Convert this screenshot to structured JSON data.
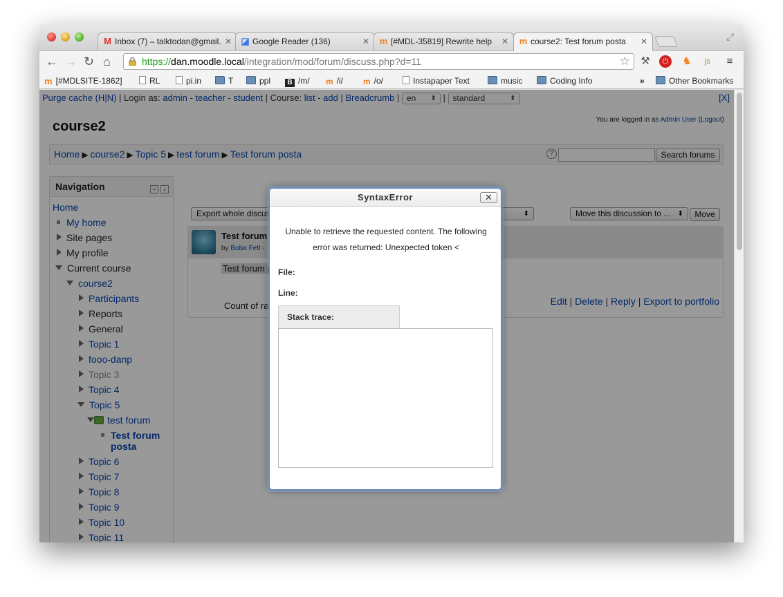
{
  "browser": {
    "tabs": [
      {
        "icon": "gmail",
        "label": "Inbox (7) – talktodan@gmail."
      },
      {
        "icon": "google-reader",
        "label": "Google Reader (136)"
      },
      {
        "icon": "moodle",
        "label": "[#MDL-35819] Rewrite help"
      },
      {
        "icon": "moodle",
        "label": "course2: Test forum posta"
      }
    ],
    "url": {
      "scheme": "https://",
      "host": "dan.moodle.local",
      "path": "/integration/mod/forum/discuss.php?d=11"
    },
    "bookmarks": [
      {
        "icon": "moodle",
        "label": "[#MDLSITE-1862]"
      },
      {
        "icon": "page",
        "label": "RL"
      },
      {
        "icon": "page",
        "label": "pi.in"
      },
      {
        "icon": "folder",
        "label": "T"
      },
      {
        "icon": "folder",
        "label": "ppl"
      },
      {
        "icon": "b",
        "label": "/m/"
      },
      {
        "icon": "moodle",
        "label": "/i/"
      },
      {
        "icon": "moodle",
        "label": "/o/"
      },
      {
        "icon": "page",
        "label": "Instapaper Text"
      },
      {
        "icon": "folder",
        "label": "music"
      },
      {
        "icon": "folder",
        "label": "Coding Info"
      }
    ],
    "bookmarks_more": "»",
    "other_bookmarks": "Other Bookmarks"
  },
  "devbar": {
    "purge": "Purge cache (H|N)",
    "sep1": " | Login as: ",
    "admin": "admin",
    "dash1": " - ",
    "teacher": "teacher",
    "dash2": " - ",
    "student": "student",
    "sep2": " | Course: ",
    "list": "list",
    "dash3": " - ",
    "add": "add",
    "sep3": " | ",
    "breadcrumb": "Breadcrumb",
    "sep4": " | ",
    "lang": "en",
    "sep5": " | ",
    "theme": "standard",
    "close": "[X]"
  },
  "header": {
    "course_title": "course2",
    "logged_prefix": "You are logged in as ",
    "user": "Admin User",
    "logout_open": " (",
    "logout": "Logout",
    "logout_close": ")"
  },
  "breadcrumb": [
    "Home",
    "course2",
    "Topic 5",
    "test forum",
    "Test forum posta"
  ],
  "breadcrumb_sep": "▶",
  "search": {
    "help": "?",
    "button": "Search forums"
  },
  "navigation": {
    "title": "Navigation",
    "items": [
      {
        "label": "Home"
      },
      {
        "label": "My home"
      },
      {
        "label": "Site pages"
      },
      {
        "label": "My profile"
      },
      {
        "label": "Current course"
      },
      {
        "label": "course2"
      },
      {
        "label": "Participants"
      },
      {
        "label": "Reports"
      },
      {
        "label": "General"
      },
      {
        "label": "Topic 1"
      },
      {
        "label": "fooo-danp"
      },
      {
        "label": "Topic 3"
      },
      {
        "label": "Topic 4"
      },
      {
        "label": "Topic 5"
      },
      {
        "label": "test forum"
      },
      {
        "label": "Test forum posta"
      },
      {
        "label": "Topic 6"
      },
      {
        "label": "Topic 7"
      },
      {
        "label": "Topic 8"
      },
      {
        "label": "Topic 9"
      },
      {
        "label": "Topic 10"
      },
      {
        "label": "Topic 11"
      }
    ]
  },
  "discussion": {
    "export_select": "Export whole discus",
    "move_select": "Move this discussion to ...",
    "move_button": "Move",
    "post_subject": "Test forum",
    "by_prefix": "by ",
    "author": "Boba Fett",
    "author_suffix": " -",
    "message": "Test forum p",
    "count": "Count of rat",
    "commands": {
      "edit": "Edit",
      "delete": "Delete",
      "reply": "Reply",
      "export": "Export to portfolio",
      "sep": " | "
    }
  },
  "dialog": {
    "title": "SyntaxError",
    "close": "✕",
    "message": "Unable to retrieve the requested content. The following error was returned: Unexpected token <",
    "file_label": "File:",
    "line_label": "Line:",
    "stack_label": "Stack trace:"
  }
}
